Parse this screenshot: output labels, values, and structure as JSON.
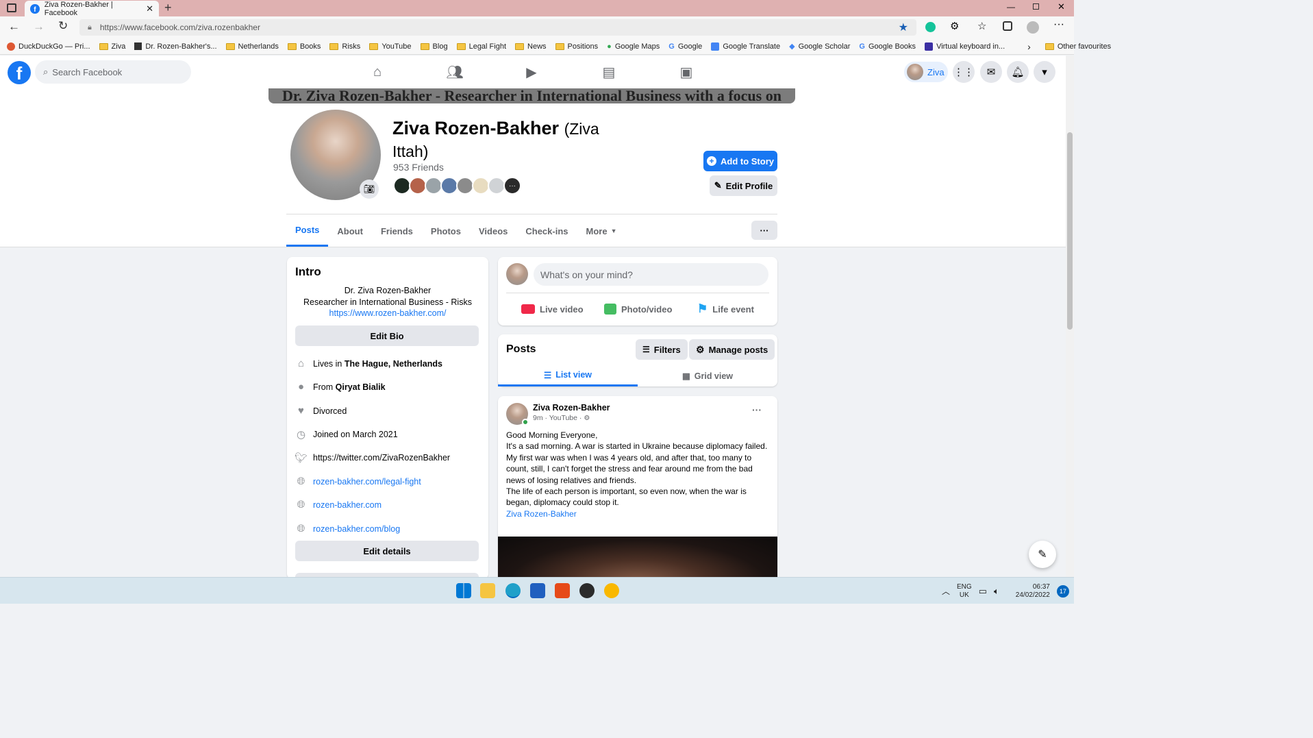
{
  "browser": {
    "tab_title": "Ziva Rozen-Bakher | Facebook",
    "url": "https://www.facebook.com/ziva.rozenbakher",
    "bookmarks": [
      "DuckDuckGo — Pri...",
      "Ziva",
      "Dr. Rozen-Bakher's...",
      "Netherlands",
      "Books",
      "Risks",
      "YouTube",
      "Blog",
      "Legal Fight",
      "News",
      "Positions",
      "Google Maps",
      "Google",
      "Google Translate",
      "Google Scholar",
      "Google Books",
      "Virtual keyboard in..."
    ],
    "other_favourites": "Other favourites"
  },
  "fbheader": {
    "search_placeholder": "Search Facebook",
    "profile_name": "Ziva"
  },
  "profile": {
    "cover_text": "Dr. Ziva Rozen-Bakher - Researcher in International Business with a focus on Risks",
    "name": "Ziva Rozen-Bakher",
    "alt_name": "(Ziva Ittah)",
    "friends": "953 Friends",
    "add_story": "Add to Story",
    "edit_profile": "Edit Profile",
    "tabs": [
      "Posts",
      "About",
      "Friends",
      "Photos",
      "Videos",
      "Check-ins",
      "More"
    ]
  },
  "intro": {
    "title": "Intro",
    "bio_line1": "Dr. Ziva Rozen-Bakher",
    "bio_line2": "Researcher in International Business - Risks",
    "bio_link": "https://www.rozen-bakher.com/",
    "edit_bio": "Edit Bio",
    "lives_prefix": "Lives in",
    "lives": "The Hague, Netherlands",
    "from_prefix": "From",
    "from": "Qiryat Bialik",
    "relationship": "Divorced",
    "joined": "Joined on March 2021",
    "twitter": "https://twitter.com/ZivaRozenBakher",
    "link1": "rozen-bakher.com/legal-fight",
    "link2": "rozen-bakher.com",
    "link3": "rozen-bakher.com/blog",
    "edit_details": "Edit details"
  },
  "composer": {
    "placeholder": "What's on your mind?",
    "live": "Live video",
    "photo": "Photo/video",
    "life": "Life event"
  },
  "posts_header": {
    "title": "Posts",
    "filters": "Filters",
    "manage": "Manage posts",
    "list_view": "List view",
    "grid_view": "Grid view"
  },
  "post": {
    "author": "Ziva Rozen-Bakher",
    "meta": "9m · YouTube ·",
    "lines": [
      "Good Morning Everyone,",
      "It's a sad morning. A war is started in Ukraine because diplomacy failed.",
      "My first war was when I was 4 years old, and after that, too many to count, still, I can't forget the stress and fear around me from the bad news of losing relatives and friends.",
      "The life of each person is important, so even now, when the war is began, diplomacy could stop it."
    ],
    "tag": "Ziva Rozen-Bakher"
  },
  "taskbar": {
    "lang1": "ENG",
    "lang2": "UK",
    "time": "06:37",
    "date": "24/02/2022",
    "notif_count": "17"
  },
  "colors": {
    "fb_blue": "#1877f2",
    "tabstrip": "#dfb1b1",
    "taskbar": "#d7e6ee"
  }
}
